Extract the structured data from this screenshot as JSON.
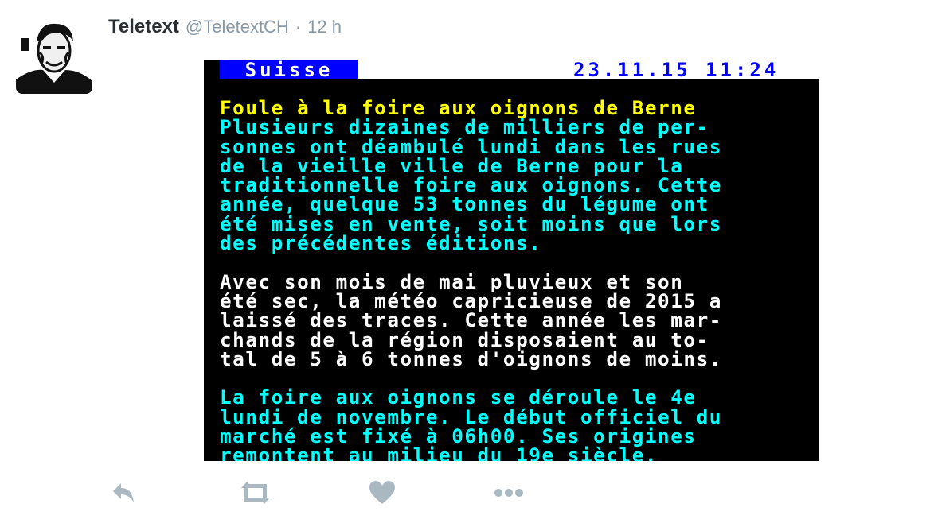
{
  "tweet": {
    "display_name": "Teletext",
    "handle": "@TeletextCH",
    "separator": "·",
    "time": "12 h"
  },
  "teletext": {
    "section": "Suisse",
    "datetime": "23.11.15 11:24",
    "paragraphs": [
      {
        "lines": [
          {
            "text": "Foule à la foire aux oignons de Berne",
            "color": "yellow"
          },
          {
            "text": "Plusieurs dizaines de milliers de per-",
            "color": "cyan"
          },
          {
            "text": "sonnes ont déambulé lundi dans les rues",
            "color": "cyan"
          },
          {
            "text": "de la vieille ville de Berne pour la",
            "color": "cyan"
          },
          {
            "text": "traditionnelle foire aux oignons. Cette",
            "color": "cyan"
          },
          {
            "text": "année, quelque 53 tonnes du légume ont",
            "color": "cyan"
          },
          {
            "text": "été mises en vente, soit moins que lors",
            "color": "cyan"
          },
          {
            "text": "des précédentes éditions.",
            "color": "cyan"
          }
        ]
      },
      {
        "lines": [
          {
            "text": "Avec son mois de mai pluvieux et son",
            "color": "white"
          },
          {
            "text": "été sec, la météo capricieuse de 2015 a",
            "color": "white"
          },
          {
            "text": "laissé des traces. Cette année les mar-",
            "color": "white"
          },
          {
            "text": "chands de la région disposaient au to-",
            "color": "white"
          },
          {
            "text": "tal de 5 à 6 tonnes d'oignons de moins.",
            "color": "white"
          }
        ]
      },
      {
        "lines": [
          {
            "text": "La foire aux oignons se déroule le 4e",
            "color": "cyan"
          },
          {
            "text": "lundi de novembre. Le début officiel du",
            "color": "cyan"
          },
          {
            "text": "marché est fixé à 06h00. Ses origines",
            "color": "cyan"
          },
          {
            "text": "remontent au milieu du 19e siècle.",
            "color": "cyan"
          }
        ]
      }
    ]
  },
  "actions": [
    {
      "name": "reply-icon"
    },
    {
      "name": "retweet-icon"
    },
    {
      "name": "like-icon"
    },
    {
      "name": "more-icon"
    }
  ],
  "colors": {
    "icon_gray": "#aab8c2",
    "teletext_yellow": "#ffff00",
    "teletext_cyan": "#00ffff",
    "teletext_blue": "#0000ff"
  }
}
